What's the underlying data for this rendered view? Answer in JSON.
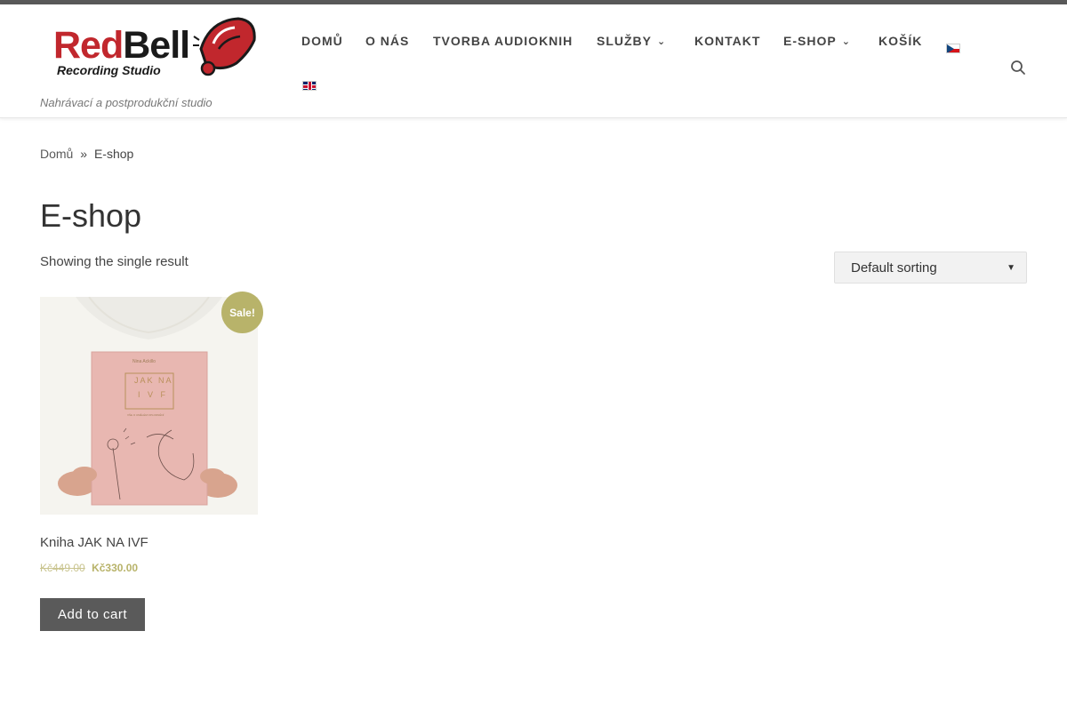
{
  "colors": {
    "accent": "#b8b36a",
    "logo_red": "#c1272d",
    "button_bg": "#5a5a5a",
    "topbar": "#595959"
  },
  "header": {
    "logo": {
      "text_red": "Red",
      "text_dark": "Bell",
      "subtitle": "Recording Studio",
      "icon": "bell-logo-icon"
    },
    "tagline": "Nahrávací a postprodukční studio",
    "nav": [
      {
        "label": "DOMŮ",
        "has_dropdown": false
      },
      {
        "label": "O NÁS",
        "has_dropdown": false
      },
      {
        "label": "TVORBA AUDIOKNIH",
        "has_dropdown": false
      },
      {
        "label": "SLUŽBY",
        "has_dropdown": true
      },
      {
        "label": "KONTAKT",
        "has_dropdown": false
      },
      {
        "label": "E-SHOP",
        "has_dropdown": true
      },
      {
        "label": "KOŠÍK",
        "has_dropdown": false
      }
    ],
    "languages": [
      {
        "code": "cs",
        "icon": "czech-flag-icon"
      },
      {
        "code": "en",
        "icon": "uk-flag-icon"
      }
    ],
    "search_icon": "search-icon"
  },
  "breadcrumb": {
    "home": "Domů",
    "separator": "»",
    "current": "E-shop"
  },
  "page": {
    "title": "E-shop",
    "result_count": "Showing the single result",
    "sorting": {
      "selected": "Default sorting"
    }
  },
  "products": [
    {
      "title": "Kniha JAK NA IVF",
      "badge": "Sale!",
      "old_price": "Kč449.00",
      "new_price": "Kč330.00",
      "add_to_cart": "Add to cart",
      "image": {
        "author": "Nina Ackillo",
        "cover_title_line1": "JAK NA",
        "cover_title_line2": "I V F",
        "cover_subtitle": "VŠE O UMĚLÉM OPLODNĚNÍ"
      }
    }
  ]
}
